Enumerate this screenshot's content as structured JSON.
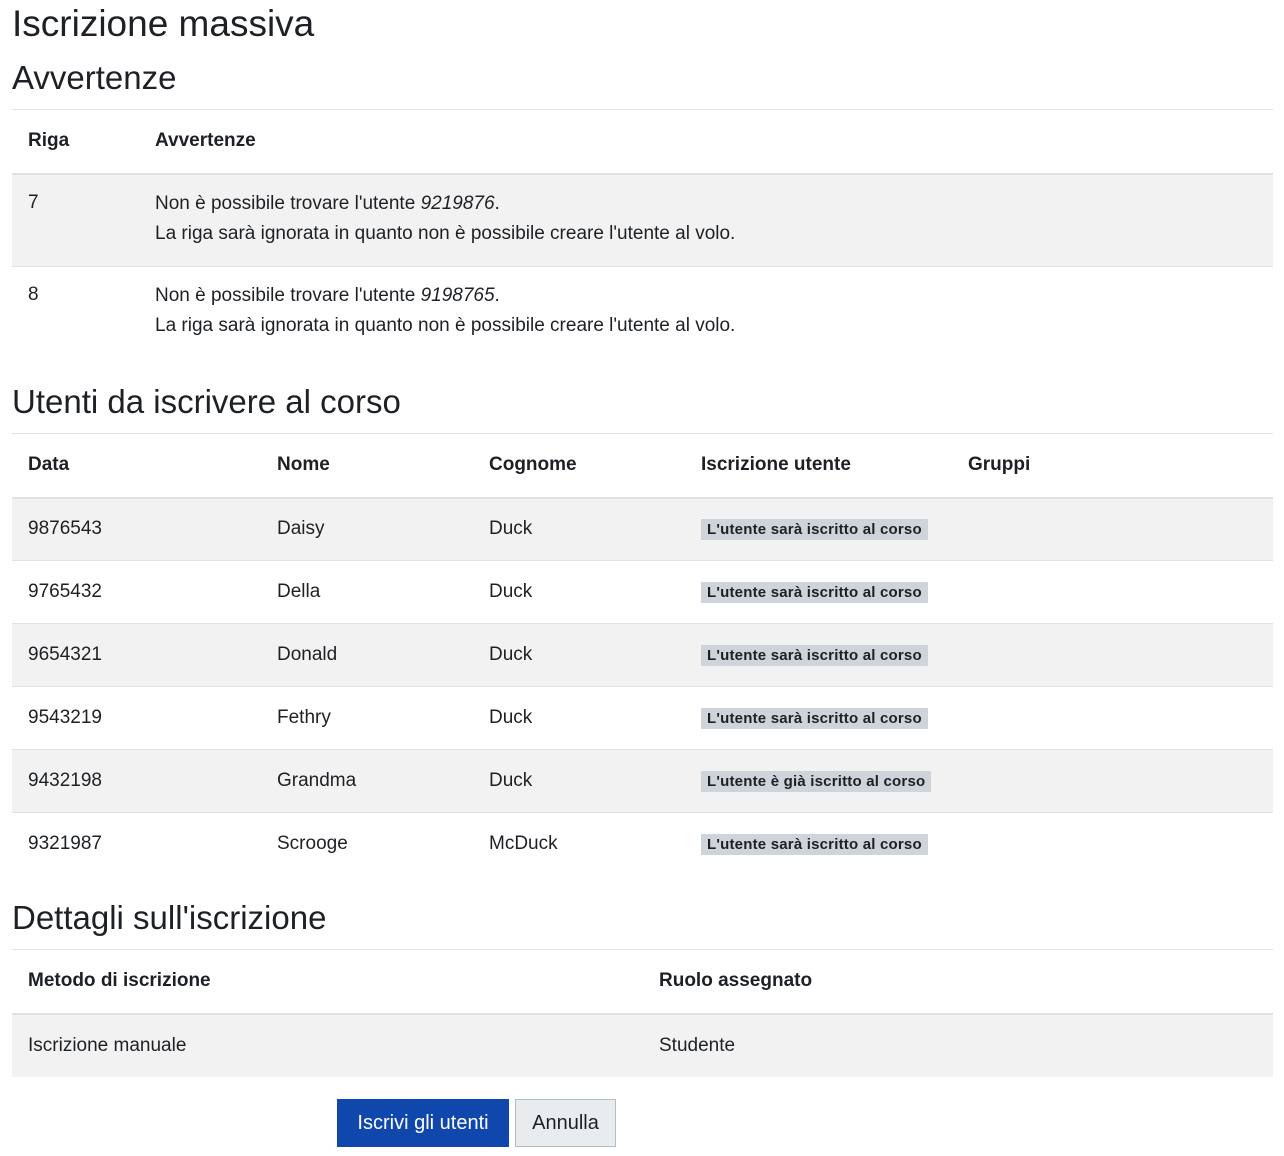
{
  "page_title": "Iscrizione massiva",
  "warnings": {
    "title": "Avvertenze",
    "headers": {
      "row": "Riga",
      "warning": "Avvertenze"
    },
    "rows": [
      {
        "row": "7",
        "line1_prefix": "Non è possibile trovare l'utente ",
        "user": "9219876",
        "line1_suffix": ".",
        "line2": "La riga sarà ignorata in quanto non è possibile creare l'utente al volo."
      },
      {
        "row": "8",
        "line1_prefix": "Non è possibile trovare l'utente ",
        "user": "9198765",
        "line1_suffix": ".",
        "line2": "La riga sarà ignorata in quanto non è possibile creare l'utente al volo."
      }
    ]
  },
  "users": {
    "title": "Utenti da iscrivere al corso",
    "headers": {
      "data": "Data",
      "nome": "Nome",
      "cognome": "Cognome",
      "iscrizione": "Iscrizione utente",
      "gruppi": "Gruppi"
    },
    "rows": [
      {
        "data": "9876543",
        "nome": "Daisy",
        "cognome": "Duck",
        "status": "L'utente sarà iscritto al corso",
        "gruppi": ""
      },
      {
        "data": "9765432",
        "nome": "Della",
        "cognome": "Duck",
        "status": "L'utente sarà iscritto al corso",
        "gruppi": ""
      },
      {
        "data": "9654321",
        "nome": "Donald",
        "cognome": "Duck",
        "status": "L'utente sarà iscritto al corso",
        "gruppi": ""
      },
      {
        "data": "9543219",
        "nome": "Fethry",
        "cognome": "Duck",
        "status": "L'utente sarà iscritto al corso",
        "gruppi": ""
      },
      {
        "data": "9432198",
        "nome": "Grandma",
        "cognome": "Duck",
        "status": "L'utente è già iscritto al corso",
        "gruppi": ""
      },
      {
        "data": "9321987",
        "nome": "Scrooge",
        "cognome": "McDuck",
        "status": "L'utente sarà iscritto al corso",
        "gruppi": ""
      }
    ]
  },
  "details": {
    "title": "Dettagli sull'iscrizione",
    "headers": {
      "method": "Metodo di iscrizione",
      "role": "Ruolo assegnato"
    },
    "row": {
      "method": "Iscrizione manuale",
      "role": "Studente"
    }
  },
  "buttons": {
    "submit": "Iscrivi gli utenti",
    "cancel": "Annulla"
  },
  "colors": {
    "primary": "#0f47ad",
    "badge": "#ced4da",
    "stripe": "#f2f2f2",
    "border": "#dee2e6",
    "text": "#1d2125"
  }
}
